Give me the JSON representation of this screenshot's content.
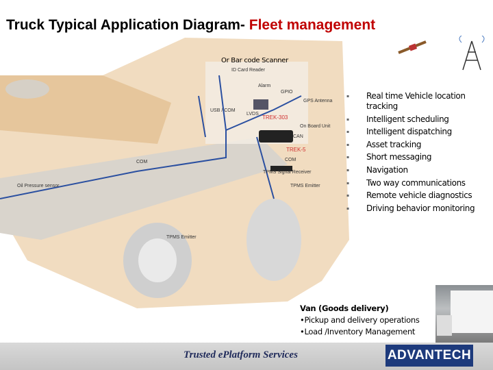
{
  "title": {
    "main": "Truck Typical Application Diagram- ",
    "accent": "Fleet management"
  },
  "diagram": {
    "scanner_label": "Or Bar code Scanner",
    "labels": [
      "ID Card Reader",
      "Alarm",
      "GPIO",
      "GPS Antenna",
      "USB / COM",
      "LVDS",
      "TREK-303",
      "On Board Unit",
      "CAN",
      "TREK-5",
      "COM",
      "TPMS Signal Receiver",
      "TPMS Emitter",
      "Oil Pressure sensor",
      "COM",
      "TPMS Emitter"
    ]
  },
  "features": [
    "Real time Vehicle location tracking",
    "Intelligent scheduling",
    "Intelligent dispatching",
    "Asset tracking",
    "Short messaging",
    "Navigation",
    "Two way communications",
    "Remote vehicle diagnostics",
    "Driving behavior monitoring"
  ],
  "van": {
    "heading": "Van (Goods delivery)",
    "items": [
      "•Pickup and delivery operations",
      "•Load /Inventory Management"
    ]
  },
  "footer": {
    "tagline": "Trusted ePlatform Services",
    "logo": "ADVANTECH"
  },
  "colors": {
    "accent": "#c00000",
    "logo_bg": "#1d3a7c",
    "cable": "#2a4fa0"
  }
}
